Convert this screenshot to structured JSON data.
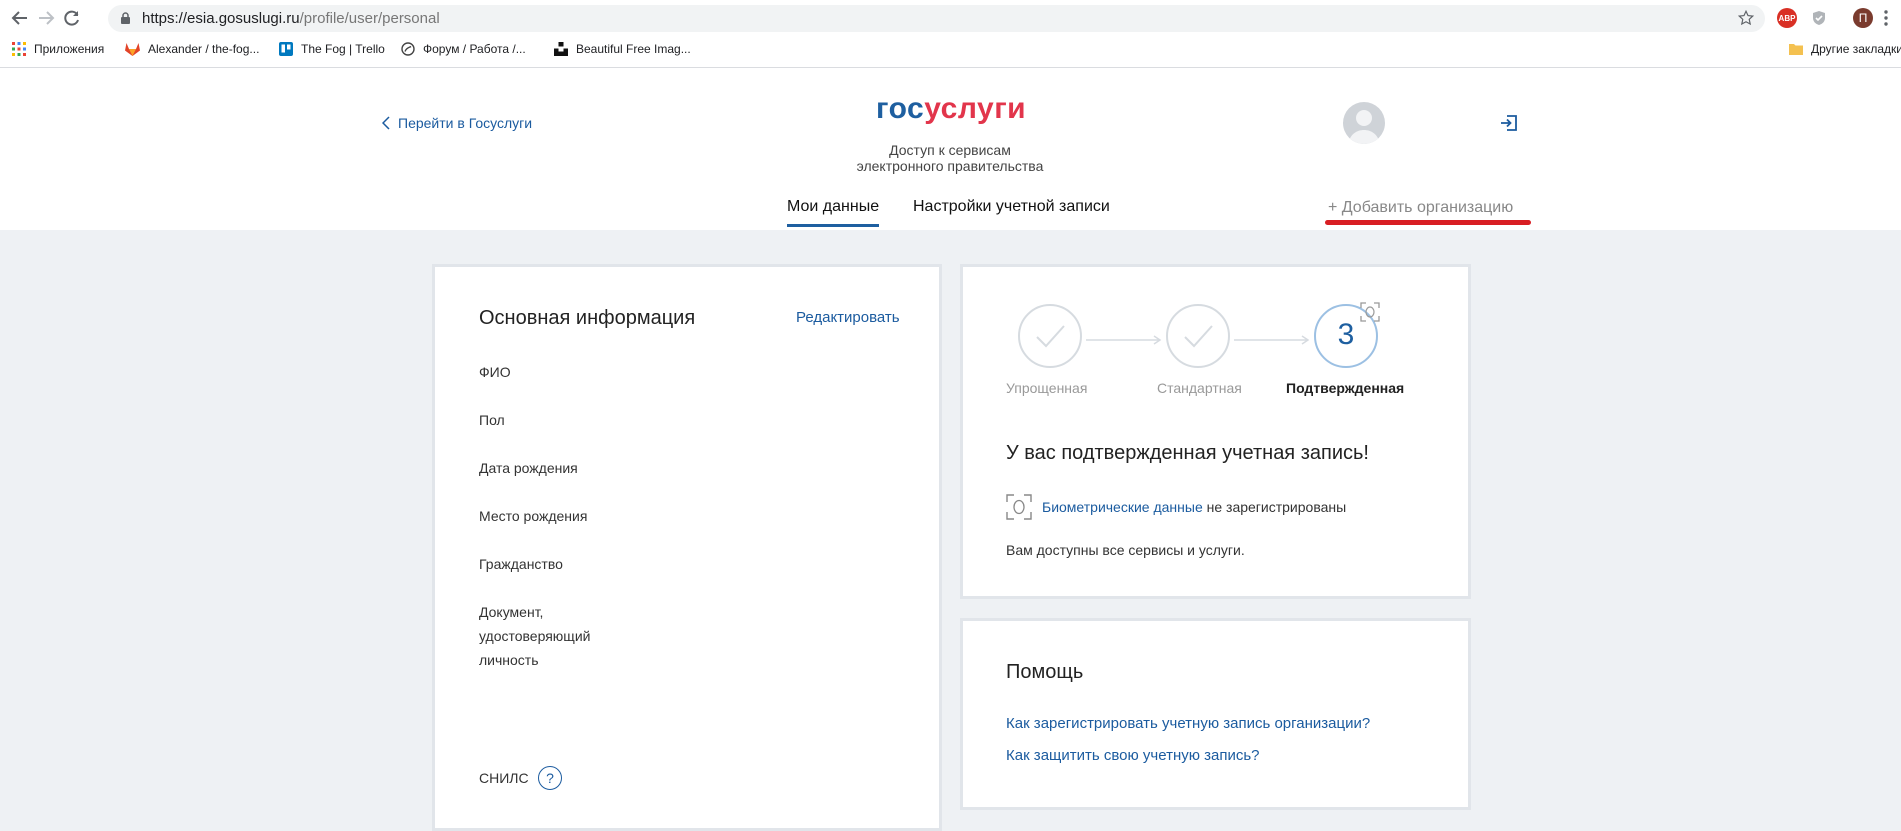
{
  "browser": {
    "url_host": "https://esia.gosuslugi.ru",
    "url_path": "/profile/user/personal",
    "profile_initial": "П",
    "abp_label": "ABP",
    "bookmarks": [
      {
        "label": "Приложения"
      },
      {
        "label": "Alexander / the-fog..."
      },
      {
        "label": "The Fog | Trello"
      },
      {
        "label": "Форум / Работа /..."
      },
      {
        "label": "Beautiful Free Imag..."
      }
    ],
    "other_bookmarks": "Другие закладки"
  },
  "header": {
    "back_link": "Перейти в Госуслуги",
    "logo_part1": "гос",
    "logo_part2": "услуги",
    "tagline_line1": "Доступ к сервисам",
    "tagline_line2": "электронного правительства",
    "tabs": [
      {
        "label": "Мои данные",
        "active": true
      },
      {
        "label": "Настройки учетной записи",
        "active": false
      }
    ],
    "add_org": "+ Добавить организацию"
  },
  "main_info": {
    "title": "Основная информация",
    "edit": "Редактировать",
    "fields": [
      "ФИО",
      "Пол",
      "Дата рождения",
      "Место рождения",
      "Гражданство"
    ],
    "document_lines": [
      "Документ,",
      "удостоверяющий",
      "личность"
    ],
    "snils": "СНИЛС",
    "snils_help": "?"
  },
  "account_status": {
    "steps": [
      {
        "label": "Упрощенная",
        "state": "done"
      },
      {
        "label": "Стандартная",
        "state": "done"
      },
      {
        "label": "Подтвержденная",
        "state": "current",
        "number": "3"
      }
    ],
    "title": "У вас подтвержденная учетная запись!",
    "biometrics_link": "Биометрические данные",
    "biometrics_status": "не зарегистрированы",
    "services_text": "Вам доступны все сервисы и услуги."
  },
  "help": {
    "title": "Помощь",
    "links": [
      "Как зарегистрировать учетную запись организации?",
      "Как защитить свою учетную запись?"
    ]
  },
  "colors": {
    "brand_blue": "#1e5fa0",
    "brand_red": "#e2354b",
    "highlight_red": "#d81e23",
    "link": "#1b5b9f"
  }
}
